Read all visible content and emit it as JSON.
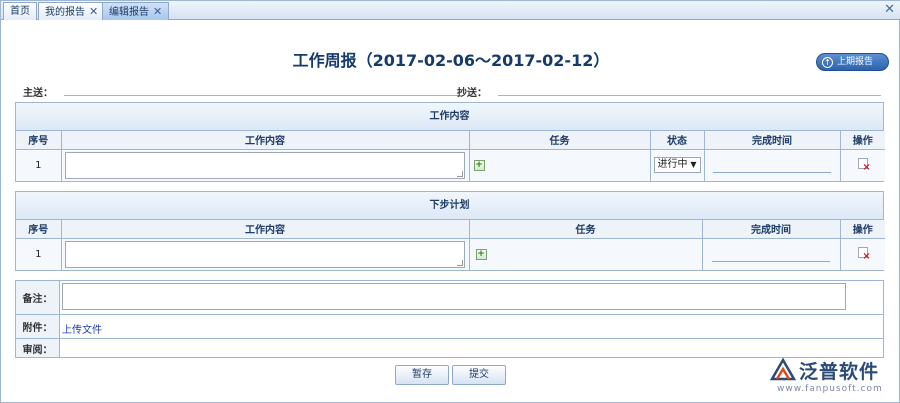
{
  "tabs": [
    {
      "label": "首页",
      "closable": false,
      "active": false
    },
    {
      "label": "我的报告",
      "closable": true,
      "active": false
    },
    {
      "label": "编辑报告",
      "closable": true,
      "active": true
    }
  ],
  "close_glyph": "✕",
  "title": "工作周报（2017-02-06～2017-02-12）",
  "prev_report_button": "上期报告",
  "recipients": {
    "to_label": "主送：",
    "cc_label": "抄送："
  },
  "work_section": {
    "heading": "工作内容",
    "columns": [
      "序号",
      "工作内容",
      "任务",
      "状态",
      "完成时间",
      "操作"
    ],
    "rows": [
      {
        "index": "1",
        "content": "",
        "status": "进行中",
        "completion_time": ""
      }
    ]
  },
  "plan_section": {
    "heading": "下步计划",
    "columns": [
      "序号",
      "工作内容",
      "任务",
      "完成时间",
      "操作"
    ],
    "rows": [
      {
        "index": "1",
        "content": "",
        "completion_time": ""
      }
    ]
  },
  "remarks": {
    "note_label": "备注：",
    "attachment_label": "附件：",
    "upload_link": "上传文件",
    "review_label": "审阅："
  },
  "actions": {
    "save_draft": "暂存",
    "submit": "提交"
  },
  "watermark": {
    "name": "泛普软件",
    "url": "www.fanpusoft.com"
  },
  "colors": {
    "accent": "#2c63ad",
    "header_bg": "#dde8f6",
    "border": "#9fb6d3",
    "link": "#1f3fb5",
    "delete": "#d01a1a"
  }
}
